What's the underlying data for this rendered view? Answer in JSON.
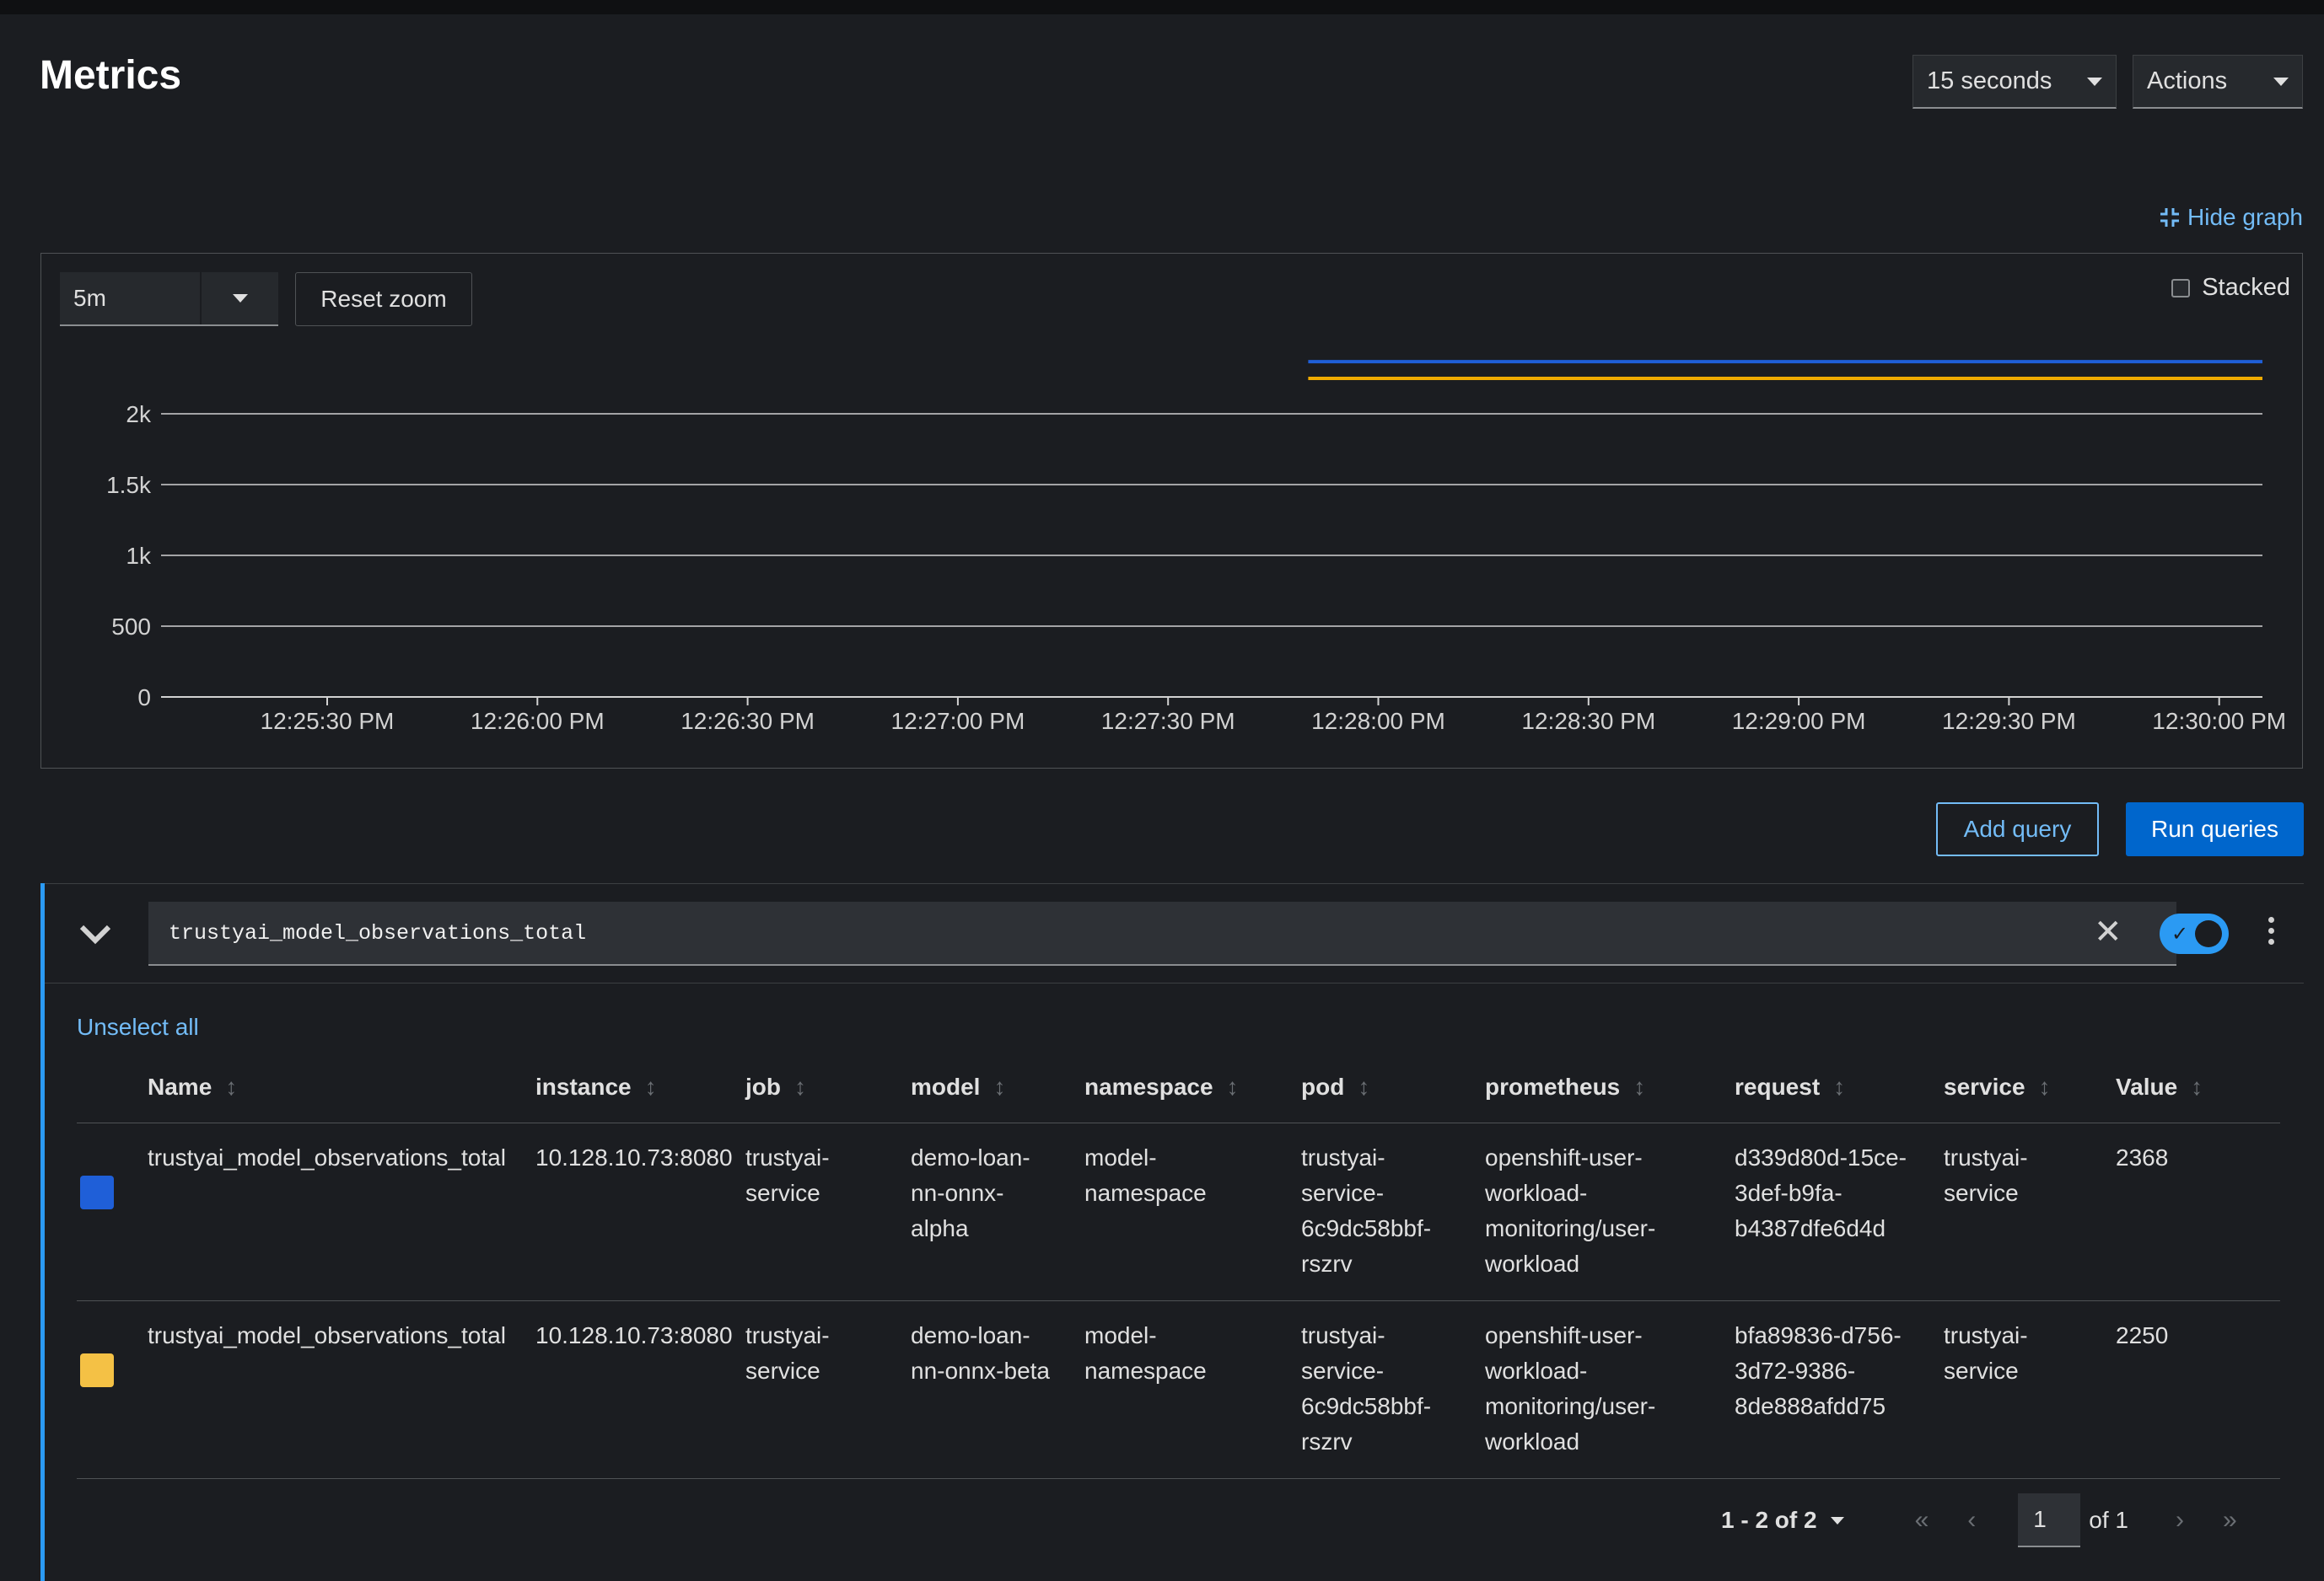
{
  "header": {
    "title": "Metrics",
    "refresh_interval": "15 seconds",
    "actions_label": "Actions"
  },
  "graph": {
    "hide_graph_label": "Hide graph",
    "time_range": "5m",
    "reset_zoom_label": "Reset zoom",
    "stacked_label": "Stacked",
    "stacked_checked": false
  },
  "chart_data": {
    "type": "line",
    "y_ticks": [
      "0",
      "500",
      "1k",
      "1.5k",
      "2k"
    ],
    "x_ticks": [
      "12:25:30 PM",
      "12:26:00 PM",
      "12:26:30 PM",
      "12:27:00 PM",
      "12:27:30 PM",
      "12:28:00 PM",
      "12:28:30 PM",
      "12:29:00 PM",
      "12:29:30 PM",
      "12:30:00 PM"
    ],
    "ylim": [
      0,
      2000
    ],
    "grid": true,
    "series": [
      {
        "color": "#1f5fd8",
        "x_start": "12:27:50 PM",
        "x_end": "12:30:00 PM",
        "value": 2368
      },
      {
        "color": "#f0ab00",
        "x_start": "12:27:50 PM",
        "x_end": "12:30:00 PM",
        "value": 2250
      }
    ]
  },
  "buttons": {
    "add_query": "Add query",
    "run_queries": "Run queries"
  },
  "query": {
    "expression": "trustyai_model_observations_total",
    "enabled": true,
    "unselect_all": "Unselect all",
    "columns": [
      "Name",
      "instance",
      "job",
      "model",
      "namespace",
      "pod",
      "prometheus",
      "request",
      "service",
      "Value"
    ],
    "rows": [
      {
        "color": "#1f5fd8",
        "name": "trustyai_model_observations_total",
        "instance": "10.128.10.73:8080",
        "job": "trustyai-\nservice",
        "model": "demo-loan-\nnn-onnx-\nalpha",
        "namespace": "model-\nnamespace",
        "pod": "trustyai-\nservice-\n6c9dc58bbf-\nrszrv",
        "prometheus": "openshift-user-\nworkload-\nmonitoring/user-\nworkload",
        "request": "d339d80d-15ce-\n3def-b9fa-\nb4387dfe6d4d",
        "service": "trustyai-\nservice",
        "value": "2368"
      },
      {
        "color": "#f4c145",
        "name": "trustyai_model_observations_total",
        "instance": "10.128.10.73:8080",
        "job": "trustyai-\nservice",
        "model": "demo-loan-\nnn-onnx-beta",
        "namespace": "model-\nnamespace",
        "pod": "trustyai-\nservice-\n6c9dc58bbf-\nrszrv",
        "prometheus": "openshift-user-\nworkload-\nmonitoring/user-\nworkload",
        "request": "bfa89836-d756-\n3d72-9386-\n8de888afdd75",
        "service": "trustyai-\nservice",
        "value": "2250"
      }
    ]
  },
  "pagination": {
    "range": "1 - 2 of 2",
    "page": "1",
    "of_pages": "of 1",
    "first": "«",
    "prev": "‹",
    "next": "›",
    "last": "»"
  }
}
